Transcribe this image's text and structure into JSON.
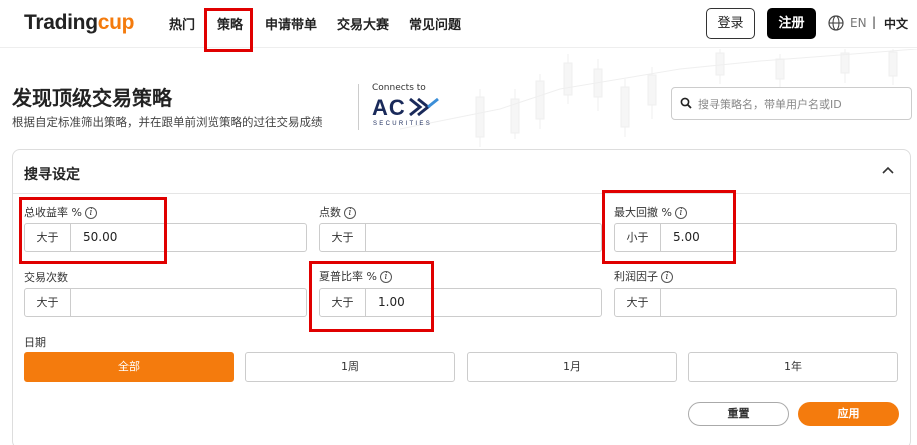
{
  "brand": {
    "part1": "Trading",
    "part2": "cup",
    "accent": "#f47b0d"
  },
  "nav": [
    "热门",
    "策略",
    "申请带单",
    "交易大赛",
    "常见问题"
  ],
  "header": {
    "login": "登录",
    "register": "注册",
    "lang_en": "EN",
    "lang_sep": "|",
    "lang_zh": "中文",
    "globe_icon": "globe-icon"
  },
  "banner": {
    "title": "发现顶级交易策略",
    "subtitle": "根据自定标准筛出策略，并在跟单前浏览策略的过往交易成绩",
    "connects": "Connects to",
    "partner": "ACY",
    "partner_sub": "SECURITIES",
    "search_placeholder": "搜寻策略名，带单用户名或ID"
  },
  "panel": {
    "title": "搜寻设定",
    "fields": [
      {
        "label": "总收益率 %",
        "info": true,
        "op": "大于",
        "value": "50.00"
      },
      {
        "label": "点数",
        "info": true,
        "op": "大于",
        "value": ""
      },
      {
        "label": "最大回撤 %",
        "info": true,
        "op": "小于",
        "value": "5.00"
      },
      {
        "label": "交易次数",
        "info": false,
        "op": "大于",
        "value": ""
      },
      {
        "label": "夏普比率 %",
        "info": true,
        "op": "大于",
        "value": "1.00"
      },
      {
        "label": "利润因子",
        "info": true,
        "op": "大于",
        "value": ""
      }
    ],
    "date_label": "日期",
    "date_options": [
      "全部",
      "1周",
      "1月",
      "1年"
    ],
    "date_selected": "全部",
    "reset": "重置",
    "apply": "应用"
  }
}
